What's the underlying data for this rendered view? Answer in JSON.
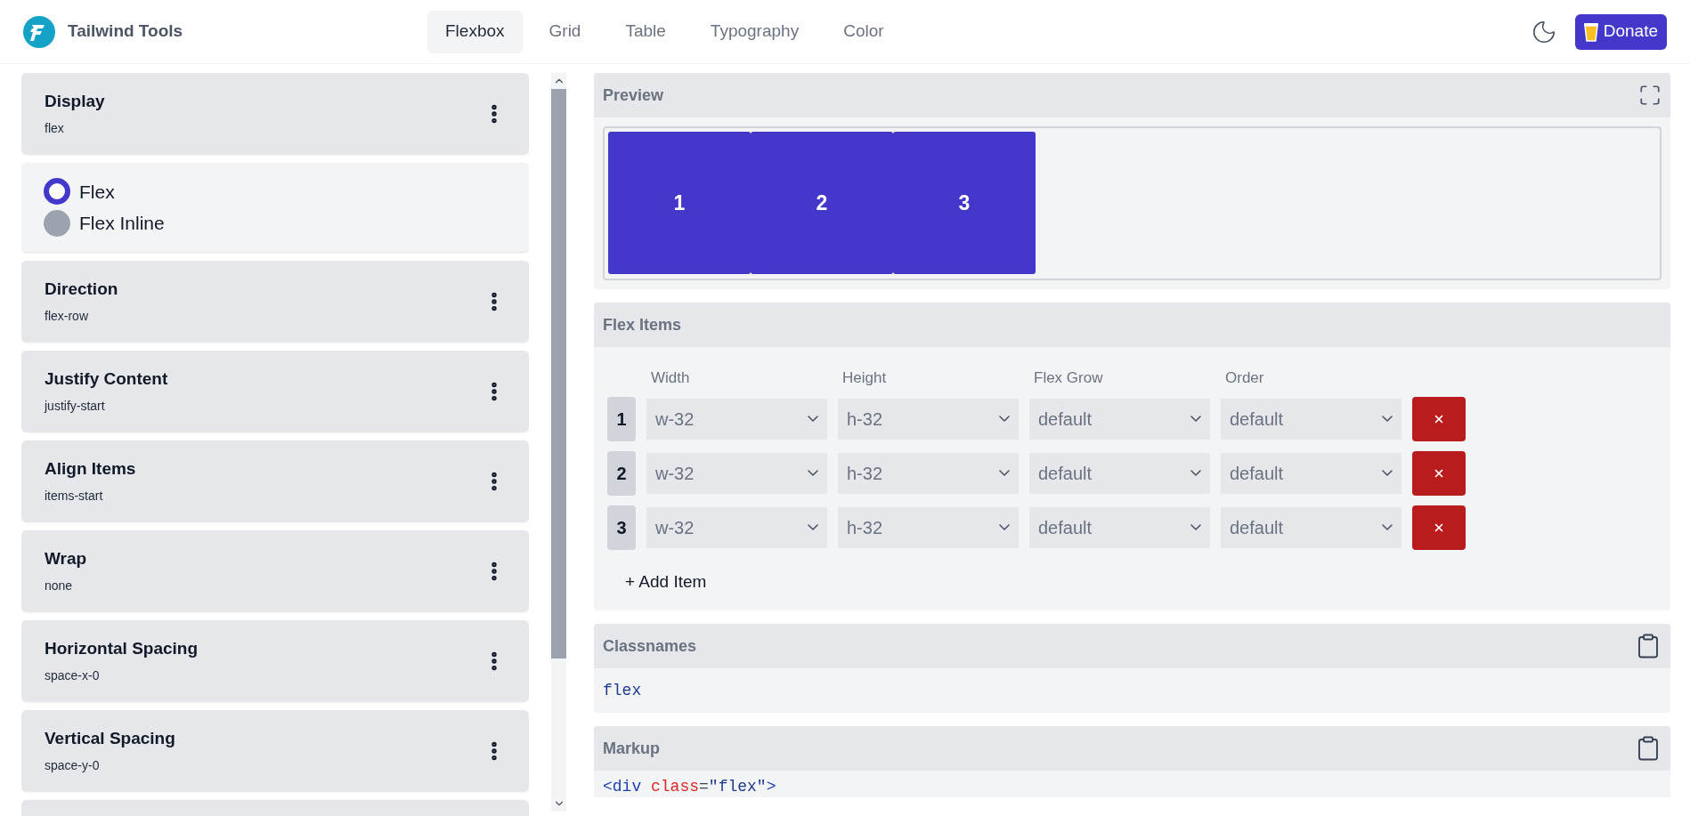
{
  "header": {
    "brand": "Tailwind Tools",
    "tabs": [
      {
        "label": "Flexbox",
        "selected": true
      },
      {
        "label": "Grid",
        "selected": false
      },
      {
        "label": "Table",
        "selected": false
      },
      {
        "label": "Typography",
        "selected": false
      },
      {
        "label": "Color",
        "selected": false
      }
    ],
    "donate": "Donate"
  },
  "sidebar": {
    "cards": [
      {
        "kind": "setting",
        "title": "Display",
        "value": "flex"
      },
      {
        "kind": "options",
        "options": [
          {
            "label": "Flex",
            "selected": true
          },
          {
            "label": "Flex Inline",
            "selected": false
          }
        ]
      },
      {
        "kind": "setting",
        "title": "Direction",
        "value": "flex-row"
      },
      {
        "kind": "setting",
        "title": "Justify Content",
        "value": "justify-start"
      },
      {
        "kind": "setting",
        "title": "Align Items",
        "value": "items-start"
      },
      {
        "kind": "setting",
        "title": "Wrap",
        "value": "none"
      },
      {
        "kind": "setting",
        "title": "Horizontal Spacing",
        "value": "space-x-0"
      },
      {
        "kind": "setting",
        "title": "Vertical Spacing",
        "value": "space-y-0"
      },
      {
        "kind": "blank"
      }
    ]
  },
  "preview": {
    "title": "Preview",
    "boxes": [
      "1",
      "2",
      "3"
    ]
  },
  "flex_items": {
    "title": "Flex Items",
    "columns": [
      "Width",
      "Height",
      "Flex Grow",
      "Order"
    ],
    "rows": [
      {
        "label": "1",
        "values": [
          "w-32",
          "h-32",
          "default",
          "default"
        ]
      },
      {
        "label": "2",
        "values": [
          "w-32",
          "h-32",
          "default",
          "default"
        ]
      },
      {
        "label": "3",
        "values": [
          "w-32",
          "h-32",
          "default",
          "default"
        ]
      }
    ],
    "add": "+ Add Item"
  },
  "classnames": {
    "title": "Classnames",
    "code": "flex"
  },
  "markup": {
    "title": "Markup",
    "lines": [
      [
        {
          "kind": "tag",
          "text": "<div"
        },
        {
          "kind": "attr",
          "text": " class"
        },
        {
          "kind": "plain",
          "text": "="
        },
        {
          "kind": "string",
          "text": "\"flex\""
        },
        {
          "kind": "tag",
          "text": ">"
        }
      ]
    ]
  }
}
